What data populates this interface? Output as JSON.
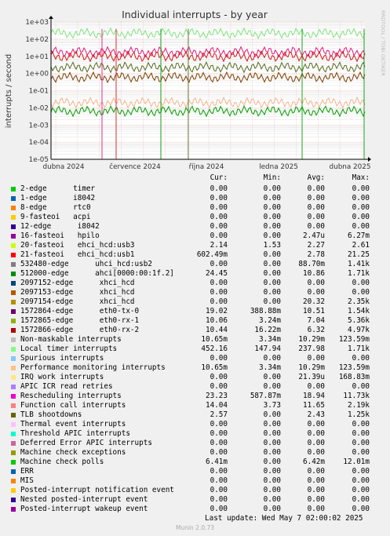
{
  "chart_data": {
    "type": "line",
    "title": "Individual interrupts - by year",
    "ylabel": "interrupts / second",
    "side_label": "RRDTOOL / TOBI OETIKER",
    "y_scale": "log",
    "ylim": [
      1e-05,
      1000
    ],
    "y_ticks": [
      "1e-05",
      "1e-04",
      "1e-03",
      "1e-02",
      "1e-01",
      "1e+00",
      "1e+01",
      "1e+02",
      "1e+03"
    ],
    "x_ticks": [
      "dubna 2024",
      "července 2024",
      "října 2024",
      "ledna 2025",
      "dubna 2025"
    ],
    "series_approx": [
      {
        "name": "Local timer interrupts",
        "color": "#7EE47E",
        "level": 220
      },
      {
        "name": "Rescheduling interrupts",
        "color": "#E6187A",
        "level": 18
      },
      {
        "name": "Function call interrupts",
        "color": "#D11A1A",
        "level": 10
      },
      {
        "name": "TLB shootdowns",
        "color": "#556B1E",
        "level": 2.3
      },
      {
        "name": "512000-edge ahci[0000:00:1f.2]",
        "color": "#804000",
        "level": 0.6
      },
      {
        "name": "Performance monitoring interrupts",
        "color": "#F5B38A",
        "level": 0.02
      },
      {
        "name": "Machine check polls",
        "color": "#00A000",
        "level": 0.0064
      }
    ]
  },
  "columns": {
    "cur": "Cur:",
    "min": "Min:",
    "avg": "Avg:",
    "max": "Max:"
  },
  "legend": [
    {
      "color": "#00CC00",
      "name": "2-edge      timer",
      "cur": "0.00",
      "min": "0.00",
      "avg": "0.00",
      "max": "0.00"
    },
    {
      "color": "#0066B3",
      "name": "1-edge      i8042",
      "cur": "0.00",
      "min": "0.00",
      "avg": "0.00",
      "max": "0.00"
    },
    {
      "color": "#FF8000",
      "name": "8-edge      rtc0",
      "cur": "0.00",
      "min": "0.00",
      "avg": "0.00",
      "max": "0.00"
    },
    {
      "color": "#FFCC00",
      "name": "9-fasteoi   acpi",
      "cur": "0.00",
      "min": "0.00",
      "avg": "0.00",
      "max": "0.00"
    },
    {
      "color": "#330099",
      "name": "12-edge      i8042",
      "cur": "0.00",
      "min": "0.00",
      "avg": "0.00",
      "max": "0.00"
    },
    {
      "color": "#990099",
      "name": "16-fasteoi   hpilo",
      "cur": "0.00",
      "min": "0.00",
      "avg": "2.47u",
      "max": "6.27m"
    },
    {
      "color": "#CCFF00",
      "name": "20-fasteoi   ehci_hcd:usb3",
      "cur": "2.14",
      "min": "1.53",
      "avg": "2.27",
      "max": "2.61"
    },
    {
      "color": "#FF0000",
      "name": "21-fasteoi   ehci_hcd:usb1",
      "cur": "602.49m",
      "min": "0.00",
      "avg": "2.78",
      "max": "21.25"
    },
    {
      "color": "#808080",
      "name": "532480-edge      uhci_hcd:usb2",
      "cur": "0.00",
      "min": "0.00",
      "avg": "88.70m",
      "max": "1.41k"
    },
    {
      "color": "#008F00",
      "name": "512000-edge      ahci[0000:00:1f.2]",
      "cur": "24.45",
      "min": "0.00",
      "avg": "10.86",
      "max": "1.71k"
    },
    {
      "color": "#00487D",
      "name": "2097152-edge      xhci_hcd",
      "cur": "0.00",
      "min": "0.00",
      "avg": "0.00",
      "max": "0.00"
    },
    {
      "color": "#B35A00",
      "name": "2097153-edge      xhci_hcd",
      "cur": "0.00",
      "min": "0.00",
      "avg": "0.00",
      "max": "0.00"
    },
    {
      "color": "#B38F00",
      "name": "2097154-edge      xhci_hcd",
      "cur": "0.00",
      "min": "0.00",
      "avg": "20.32",
      "max": "2.35k"
    },
    {
      "color": "#6B006B",
      "name": "1572864-edge      eth0-tx-0",
      "cur": "19.02",
      "min": "388.88m",
      "avg": "10.51",
      "max": "1.54k"
    },
    {
      "color": "#8FB300",
      "name": "1572865-edge      eth0-rx-1",
      "cur": "10.06",
      "min": "3.24m",
      "avg": "7.04",
      "max": "5.36k"
    },
    {
      "color": "#B30000",
      "name": "1572866-edge      eth0-rx-2",
      "cur": "10.44",
      "min": "16.22m",
      "avg": "6.32",
      "max": "4.97k"
    },
    {
      "color": "#BEBEBE",
      "name": "Non-maskable interrupts",
      "cur": "10.65m",
      "min": "3.34m",
      "avg": "10.29m",
      "max": "123.59m"
    },
    {
      "color": "#80FF80",
      "name": "Local timer interrupts",
      "cur": "452.16",
      "min": "147.94",
      "avg": "237.98",
      "max": "1.71k"
    },
    {
      "color": "#80C9FF",
      "name": "Spurious interrupts",
      "cur": "0.00",
      "min": "0.00",
      "avg": "0.00",
      "max": "0.00"
    },
    {
      "color": "#FFC080",
      "name": "Performance monitoring interrupts",
      "cur": "10.65m",
      "min": "3.34m",
      "avg": "10.29m",
      "max": "123.59m"
    },
    {
      "color": "#FFE680",
      "name": "IRQ work interrupts",
      "cur": "0.00",
      "min": "0.00",
      "avg": "21.39u",
      "max": "168.83m"
    },
    {
      "color": "#AA80FF",
      "name": "APIC ICR read retries",
      "cur": "0.00",
      "min": "0.00",
      "avg": "0.00",
      "max": "0.00"
    },
    {
      "color": "#EE00CC",
      "name": "Rescheduling interrupts",
      "cur": "23.23",
      "min": "587.87m",
      "avg": "18.94",
      "max": "11.73k"
    },
    {
      "color": "#FF8080",
      "name": "Function call interrupts",
      "cur": "14.04",
      "min": "3.73",
      "avg": "11.65",
      "max": "2.19k"
    },
    {
      "color": "#666600",
      "name": "TLB shootdowns",
      "cur": "2.57",
      "min": "0.00",
      "avg": "2.43",
      "max": "1.25k"
    },
    {
      "color": "#FFBFFF",
      "name": "Thermal event interrupts",
      "cur": "0.00",
      "min": "0.00",
      "avg": "0.00",
      "max": "0.00"
    },
    {
      "color": "#00FFCC",
      "name": "Threshold APIC interrupts",
      "cur": "0.00",
      "min": "0.00",
      "avg": "0.00",
      "max": "0.00"
    },
    {
      "color": "#CC6699",
      "name": "Deferred Error APIC interrupts",
      "cur": "0.00",
      "min": "0.00",
      "avg": "0.00",
      "max": "0.00"
    },
    {
      "color": "#999900",
      "name": "Machine check exceptions",
      "cur": "0.00",
      "min": "0.00",
      "avg": "0.00",
      "max": "0.00"
    },
    {
      "color": "#00CC00",
      "name": "Machine check polls",
      "cur": "6.41m",
      "min": "0.00",
      "avg": "6.42m",
      "max": "12.01m"
    },
    {
      "color": "#0066B3",
      "name": "ERR",
      "cur": "0.00",
      "min": "0.00",
      "avg": "0.00",
      "max": "0.00"
    },
    {
      "color": "#FF8000",
      "name": "MIS",
      "cur": "0.00",
      "min": "0.00",
      "avg": "0.00",
      "max": "0.00"
    },
    {
      "color": "#FFCC00",
      "name": "Posted-interrupt notification event",
      "cur": "0.00",
      "min": "0.00",
      "avg": "0.00",
      "max": "0.00"
    },
    {
      "color": "#330099",
      "name": "Nested posted-interrupt event",
      "cur": "0.00",
      "min": "0.00",
      "avg": "0.00",
      "max": "0.00"
    },
    {
      "color": "#990099",
      "name": "Posted-interrupt wakeup event",
      "cur": "0.00",
      "min": "0.00",
      "avg": "0.00",
      "max": "0.00"
    }
  ],
  "footer": {
    "last_update": "Last update: Wed May  7 02:00:02 2025",
    "generator": "Munin 2.0.73"
  }
}
